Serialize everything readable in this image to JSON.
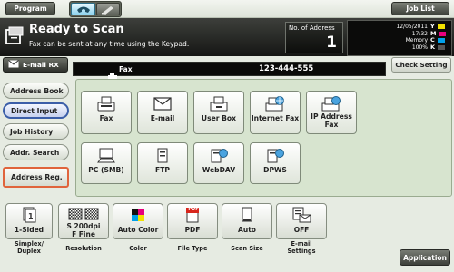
{
  "top": {
    "program_label": "Program",
    "job_list_label": "Job List"
  },
  "status": {
    "title": "Ready to Scan",
    "message": "Fax can be sent at any time using the Keypad.",
    "address_count_label": "No. of Address",
    "address_count": "1",
    "date": "12/05/2011",
    "time": "17:32",
    "memory_label": "Memory",
    "memory_value": "100%",
    "toner": [
      {
        "letter": "Y",
        "color": "#f2e200"
      },
      {
        "letter": "M",
        "color": "#e6007e"
      },
      {
        "letter": "C",
        "color": "#00a0e9"
      },
      {
        "letter": "K",
        "color": "#111111"
      }
    ]
  },
  "email_rx_label": "E-mail RX",
  "destination": {
    "type_label": "Fax",
    "number": "123-444-555"
  },
  "check_setting_label": "Check Setting",
  "sidebar": {
    "items": [
      {
        "label": "Address Book"
      },
      {
        "label": "Direct Input"
      },
      {
        "label": "Job History"
      },
      {
        "label": "Addr. Search"
      },
      {
        "label": "Address Reg."
      }
    ]
  },
  "destinations": [
    {
      "label": "Fax",
      "icon": "fax-icon"
    },
    {
      "label": "E-mail",
      "icon": "email-icon"
    },
    {
      "label": "User Box",
      "icon": "user-box-icon"
    },
    {
      "label": "Internet Fax",
      "icon": "internet-fax-icon"
    },
    {
      "label": "IP Address\nFax",
      "icon": "ip-address-fax-icon"
    },
    {
      "label": "PC (SMB)",
      "icon": "pc-icon"
    },
    {
      "label": "FTP",
      "icon": "ftp-icon"
    },
    {
      "label": "WebDAV",
      "icon": "webdav-icon"
    },
    {
      "label": "DPWS",
      "icon": "dpws-icon"
    }
  ],
  "settings": [
    {
      "value": "1-Sided",
      "caption": "Simplex/\nDuplex",
      "icon": "simplex-icon"
    },
    {
      "value": "S 200dpi\nF Fine",
      "caption": "Resolution",
      "icon": "resolution-icon"
    },
    {
      "value": "Auto Color",
      "caption": "Color",
      "icon": "color-icon"
    },
    {
      "value": "PDF",
      "caption": "File Type",
      "icon": "pdf-icon"
    },
    {
      "value": "Auto",
      "caption": "Scan Size",
      "icon": "scan-size-icon"
    },
    {
      "value": "OFF",
      "caption": "E-mail\nSettings",
      "icon": "email-settings-icon"
    }
  ],
  "pdf_badge": "PDF",
  "application_label": "Application"
}
